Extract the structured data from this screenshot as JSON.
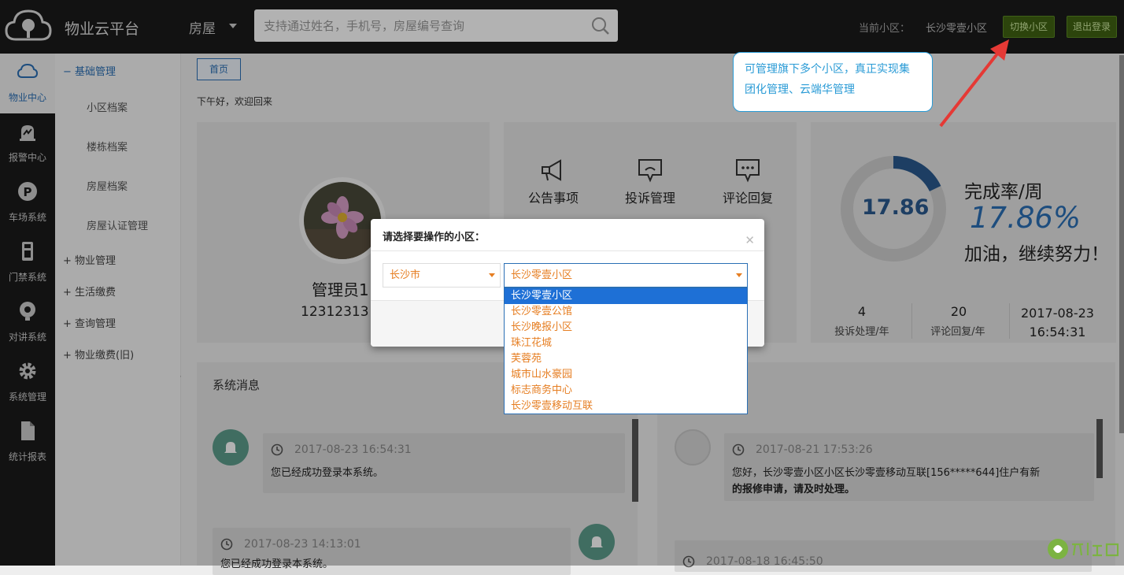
{
  "header": {
    "app_title": "物业云平台",
    "search_type": "房屋",
    "search_placeholder": "支持通过姓名，手机号，房屋编号查询",
    "current_community_label": "当前小区：",
    "current_community": "长沙零壹小区",
    "switch_button": "切换小区",
    "logout_button": "退出登录"
  },
  "sidenav": [
    {
      "label": "物业中心",
      "icon": "cloud-icon",
      "active": true
    },
    {
      "label": "报警中心",
      "icon": "alarm-icon"
    },
    {
      "label": "车场系统",
      "icon": "parking-icon"
    },
    {
      "label": "门禁系统",
      "icon": "access-control-icon"
    },
    {
      "label": "对讲系统",
      "icon": "intercom-icon"
    },
    {
      "label": "系统管理",
      "icon": "gear-icon"
    },
    {
      "label": "统计报表",
      "icon": "document-icon"
    }
  ],
  "submenu": {
    "group_open": "基础管理",
    "open_items": [
      "小区档案",
      "楼栋档案",
      "房屋档案",
      "房屋认证管理"
    ],
    "groups": [
      "物业管理",
      "生活缴费",
      "查询管理",
      "物业缴费(旧)"
    ]
  },
  "page": {
    "home_tab": "首页",
    "greeting": "下午好，欢迎回来"
  },
  "profile": {
    "name": "管理员1",
    "phone": "12312313"
  },
  "shortcuts": [
    {
      "label": "公告事项",
      "icon": "megaphone-icon"
    },
    {
      "label": "投诉管理",
      "icon": "complaint-icon"
    },
    {
      "label": "评论回复",
      "icon": "comment-icon"
    }
  ],
  "stats": {
    "ring_value": "17.86",
    "ring_fraction": 0.1786,
    "rate_title": "完成率/周",
    "rate_value": "17.86%",
    "motto": "加油，继续努力！",
    "complaints_value": "4",
    "complaints_label": "投诉处理/年",
    "comments_value": "20",
    "comments_label": "评论回复/年",
    "date": "2017-08-23",
    "time": "16:54:31"
  },
  "messages": {
    "title": "系统消息",
    "left": [
      {
        "time": "2017-08-23 16:54:31",
        "text": "您已经成功登录本系统。"
      },
      {
        "time": "2017-08-23 14:13:01",
        "text": "您已经成功登录本系统。"
      }
    ],
    "right": [
      {
        "time": "2017-08-21 17:53:26",
        "text": "您好，长沙零壹小区小区长沙零壹移动互联[156*****644]住户有新",
        "text2": "的报修申请，请及时处理。"
      },
      {
        "time": "2017-08-18 16:45:50"
      }
    ]
  },
  "tooltip": {
    "line1": "可管理旗下多个小区，真正实现集",
    "line2": "团化管理、云端华管理"
  },
  "modal": {
    "title": "请选择要操作的小区：",
    "city": "长沙市",
    "community": "长沙零壹小区",
    "options": [
      "长沙零壹小区",
      "长沙零壹公馆",
      "长沙晚报小区",
      "珠江花城",
      "芙蓉苑",
      "城市山水豪园",
      "标志商务中心",
      "长沙零壹移动互联"
    ],
    "selected_index": 0
  },
  "colors": {
    "accent": "#2a6fb5",
    "option_text": "#e67e22",
    "green_button": "#3f6212"
  }
}
